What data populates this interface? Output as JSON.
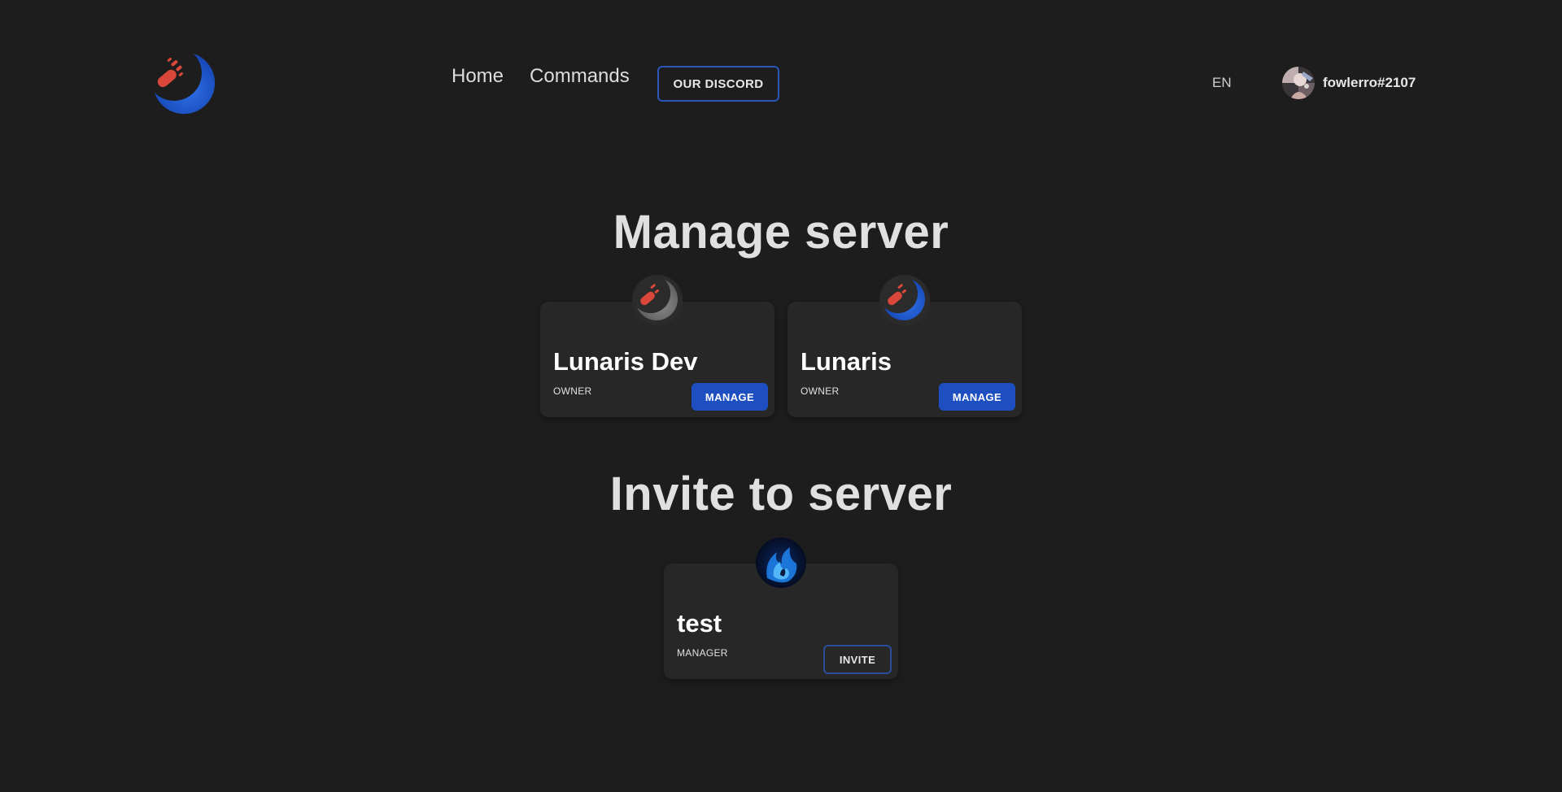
{
  "header": {
    "logo_icon": "lunaris-logo-icon",
    "nav": [
      {
        "label": "Home"
      },
      {
        "label": "Commands"
      }
    ],
    "discord_button": "OUR DISCORD",
    "language": "EN",
    "user": {
      "avatar_icon": "user-avatar-icon",
      "name": "fowlerro#2107"
    }
  },
  "manage_section": {
    "title": "Manage server",
    "servers": [
      {
        "name": "Lunaris Dev",
        "role": "OWNER",
        "button": "MANAGE",
        "icon": "lunaris-dev-logo-icon"
      },
      {
        "name": "Lunaris",
        "role": "OWNER",
        "button": "MANAGE",
        "icon": "lunaris-logo-icon"
      }
    ]
  },
  "invite_section": {
    "title": "Invite to server",
    "servers": [
      {
        "name": "test",
        "role": "MANAGER",
        "button": "INVITE",
        "icon": "blue-flame-icon"
      }
    ]
  },
  "colors": {
    "background": "#1d1d1d",
    "card": "#272727",
    "accent_blue": "#1d4fc1",
    "meteor_red": "#d9463a"
  }
}
